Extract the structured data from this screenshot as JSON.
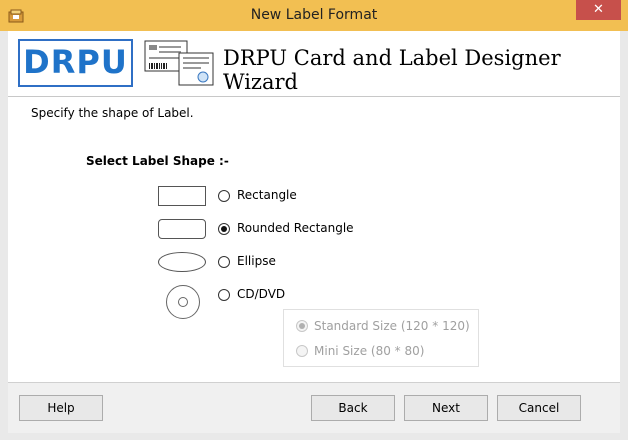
{
  "window": {
    "title": "New Label Format",
    "close_glyph": "✕"
  },
  "header": {
    "logo": "DRPU",
    "title": "DRPU Card and Label Designer Wizard"
  },
  "body": {
    "instruction": "Specify the shape of Label.",
    "section_label": "Select Label Shape :-",
    "shapes": [
      {
        "label": "Rectangle",
        "selected": false
      },
      {
        "label": "Rounded Rectangle",
        "selected": true
      },
      {
        "label": "Ellipse",
        "selected": false
      },
      {
        "label": "CD/DVD",
        "selected": false
      }
    ],
    "cd_options": [
      {
        "label": "Standard Size (120 * 120)",
        "selected": true,
        "enabled": false
      },
      {
        "label": "Mini Size (80 * 80)",
        "selected": false,
        "enabled": false
      }
    ]
  },
  "footer": {
    "help": "Help",
    "back": "Back",
    "next": "Next",
    "cancel": "Cancel"
  }
}
